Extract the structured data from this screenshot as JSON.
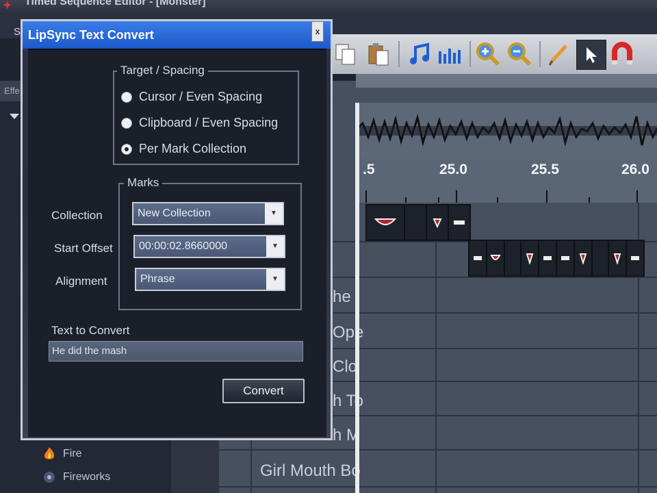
{
  "app": {
    "title": "Timed Sequence Editor - [Monster]",
    "menu_fragment": "S",
    "left_tab_fragment": "Effe",
    "effects": [
      {
        "label": "Fire",
        "icon": "fire-icon"
      },
      {
        "label": "Fireworks",
        "icon": "fireworks-icon"
      }
    ],
    "toolbar_icons": [
      "copy-icon",
      "paste-icon",
      "music-note-icon",
      "equalizer-icon",
      "zoom-in-icon",
      "zoom-out-icon",
      "pencil-icon",
      "pointer-icon",
      "magnet-icon"
    ],
    "ruler_labels": [
      ".5",
      "25.0",
      "25.5",
      "26.0"
    ],
    "row_labels": [
      "he",
      "Ope",
      "Clo",
      "h To",
      "h M",
      "Girl Mouth Bo"
    ]
  },
  "dialog": {
    "title": "LipSync Text Convert",
    "close_glyph": "x",
    "target_group": {
      "legend": "Target / Spacing",
      "options": [
        {
          "label": "Cursor / Even Spacing",
          "checked": false
        },
        {
          "label": "Clipboard / Even Spacing",
          "checked": false
        },
        {
          "label": "Per Mark Collection",
          "checked": true
        }
      ]
    },
    "marks_group": {
      "legend": "Marks",
      "collection_label": "Collection",
      "collection_value": "New Collection",
      "start_offset_label": "Start Offset",
      "start_offset_value": "00:00:02.8660000",
      "alignment_label": "Alignment",
      "alignment_value": "Phrase"
    },
    "text_to_convert_label": "Text to Convert",
    "text_to_convert_value": "He did the mash",
    "convert_label": "Convert"
  },
  "colors": {
    "dialog_title_bar": "#1c58c9",
    "dialog_body": "#1a1f29",
    "grid": "#46505f",
    "mark_mouth_red": "#b3222a"
  }
}
